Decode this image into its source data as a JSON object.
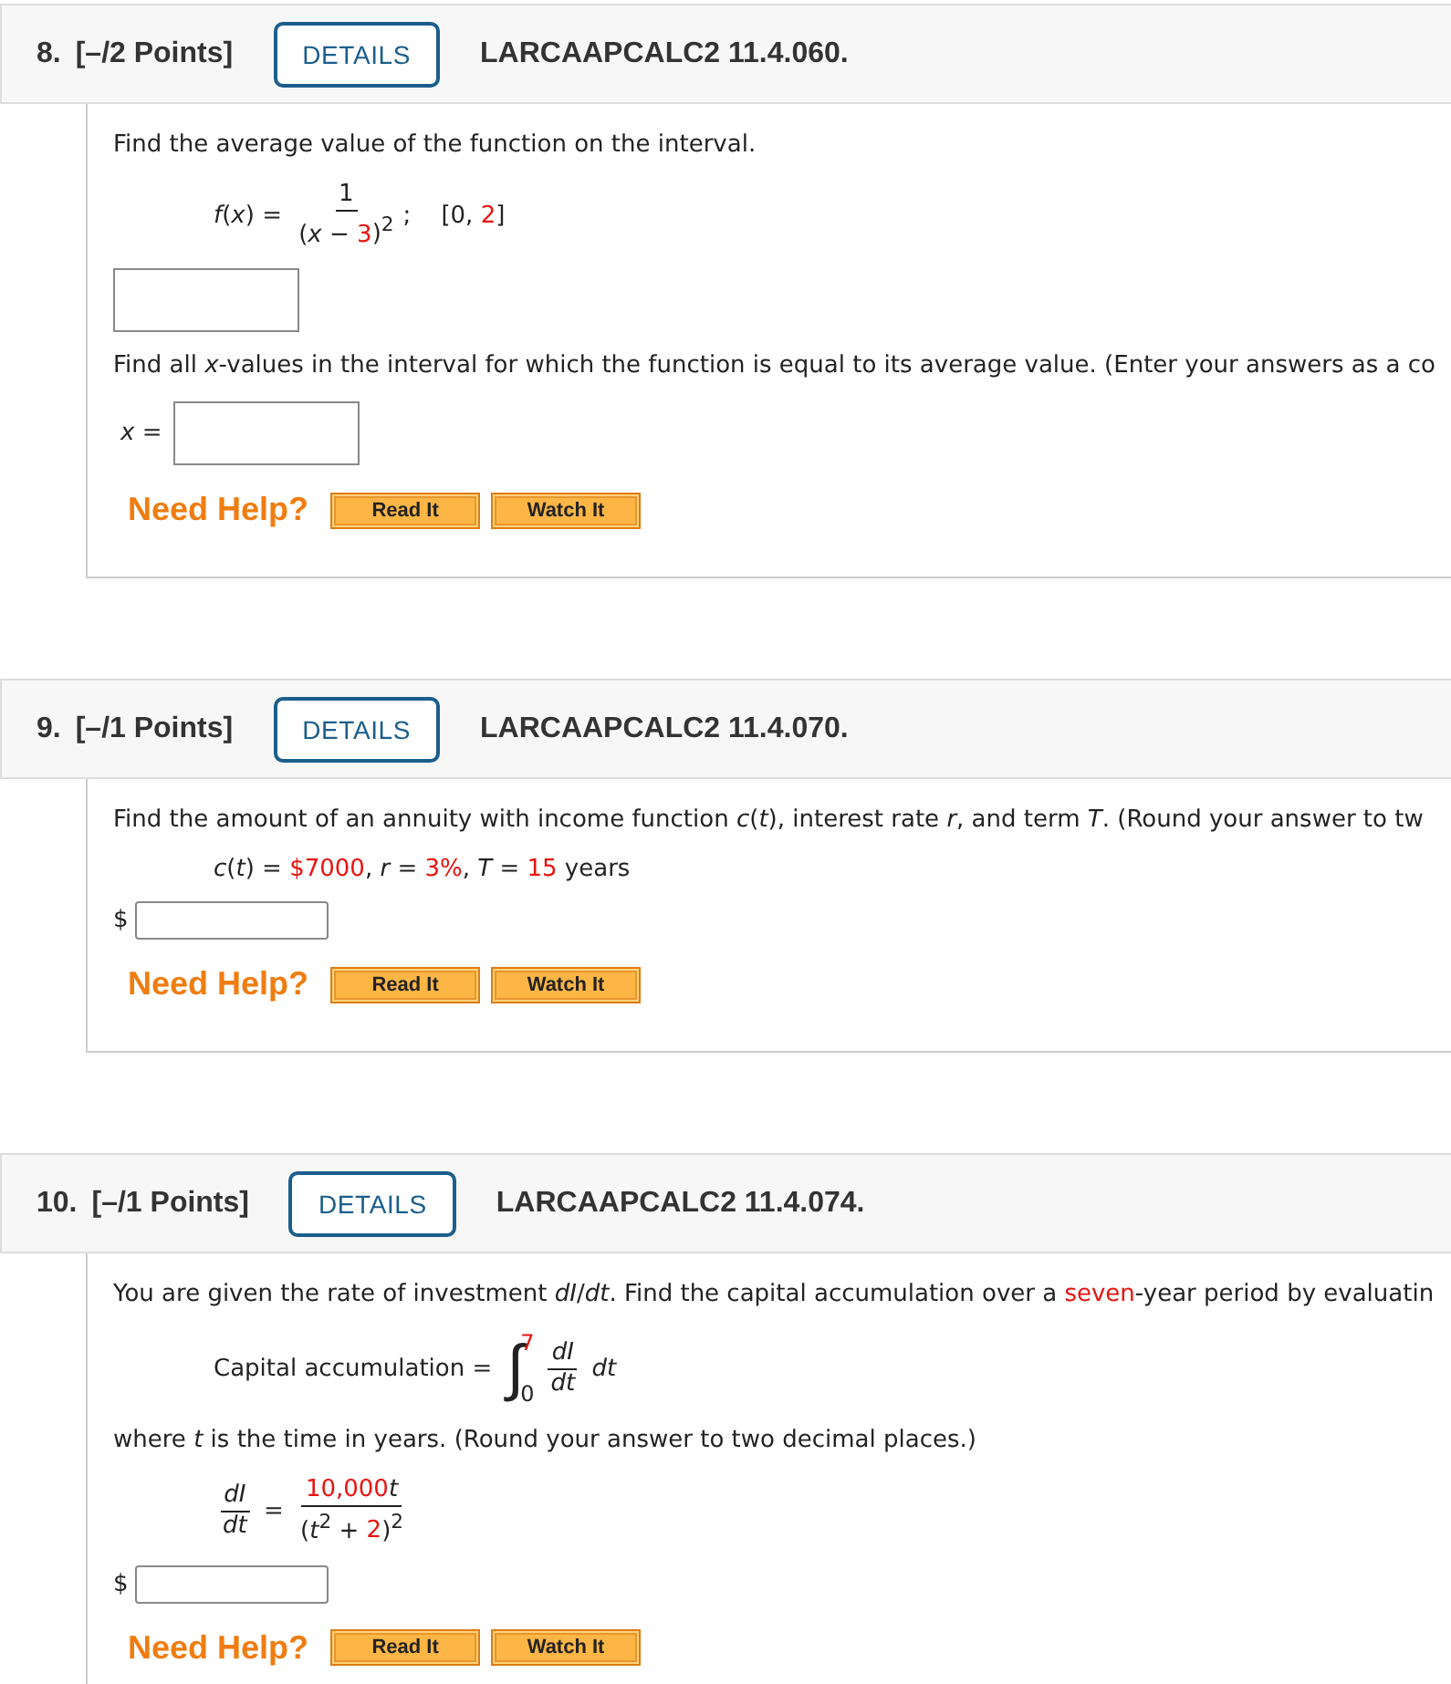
{
  "questions": [
    {
      "number": "8.",
      "points": "[–/2 Points]",
      "details_button": "DETAILS",
      "code": "LARCAAPCALC2 11.4.060.",
      "body": [
        {
          "kind": "text",
          "segments": [
            {
              "t": "Find the average value of the function on the interval.",
              "given": false
            }
          ]
        },
        {
          "kind": "formula",
          "parts": [
            {
              "kind": "seg",
              "segments": [
                {
                  "t": "*f*(*x*) = ",
                  "given": false
                }
              ]
            },
            {
              "kind": "frac",
              "num": [
                {
                  "t": "1",
                  "given": false
                }
              ],
              "den": [
                {
                  "t": "(*x* − ",
                  "given": false
                },
                {
                  "t": "3",
                  "given": true
                },
                {
                  "t": ")$^{2}$",
                  "given": false
                }
              ]
            },
            {
              "kind": "seg",
              "segments": [
                {
                  "t": ";    [0, ",
                  "given": false
                },
                {
                  "t": "2",
                  "given": true
                },
                {
                  "t": "]",
                  "given": false
                }
              ]
            }
          ]
        },
        {
          "kind": "box"
        },
        {
          "kind": "text",
          "segments": [
            {
              "t": "Find all *x*-values in the interval for which the function is equal to its average value. (Enter your answers as a co",
              "given": false
            }
          ]
        },
        {
          "kind": "labeled_box",
          "label": "*x* ="
        }
      ],
      "help": {
        "label": "Need Help?",
        "buttons": [
          "Read It",
          "Watch It"
        ]
      }
    },
    {
      "number": "9.",
      "points": "[–/1 Points]",
      "details_button": "DETAILS",
      "code": "LARCAAPCALC2 11.4.070.",
      "body": [
        {
          "kind": "text",
          "segments": [
            {
              "t": "Find the amount of an annuity with income function *c*(*t*), interest rate *r*, and term *T*. (Round your answer to tw",
              "given": false
            }
          ]
        },
        {
          "kind": "formula",
          "parts": [
            {
              "kind": "seg",
              "segments": [
                {
                  "t": "*c*(*t*) = ",
                  "given": false
                },
                {
                  "t": "$7000",
                  "given": true
                },
                {
                  "t": ", *r* = ",
                  "given": false
                },
                {
                  "t": "3%",
                  "given": true
                },
                {
                  "t": ", *T* = ",
                  "given": false
                },
                {
                  "t": "15",
                  "given": true
                },
                {
                  "t": " years",
                  "given": false
                }
              ]
            }
          ]
        },
        {
          "kind": "dollar",
          "label": "$"
        }
      ],
      "help": {
        "label": "Need Help?",
        "buttons": [
          "Read It",
          "Watch It"
        ]
      }
    },
    {
      "number": "10.",
      "points": "[–/1 Points]",
      "details_button": "DETAILS",
      "code": "LARCAAPCALC2 11.4.074.",
      "body": [
        {
          "kind": "text",
          "segments": [
            {
              "t": "You are given the rate of investment *dI*/*dt*. Find the capital accumulation over a ",
              "given": false
            },
            {
              "t": "seven",
              "given": true
            },
            {
              "t": "-year period by evaluatin",
              "given": false
            }
          ]
        },
        {
          "kind": "formula",
          "parts": [
            {
              "kind": "seg",
              "segments": [
                {
                  "t": "Capital accumulation = ",
                  "given": false
                }
              ]
            },
            {
              "kind": "integral",
              "sign": "∫",
              "upper": [
                {
                  "t": "7",
                  "given": true
                }
              ],
              "lower": [
                {
                  "t": "0",
                  "given": false
                }
              ]
            },
            {
              "kind": "frac",
              "num": [
                {
                  "t": "*dI*",
                  "given": false
                }
              ],
              "den": [
                {
                  "t": "*dt*",
                  "given": false
                }
              ]
            },
            {
              "kind": "seg",
              "segments": [
                {
                  "t": " *dt*",
                  "given": false
                }
              ]
            }
          ]
        },
        {
          "kind": "text",
          "segments": [
            {
              "t": "where *t* is the time in years. (Round your answer to two decimal places.)",
              "given": false
            }
          ]
        },
        {
          "kind": "formula",
          "parts": [
            {
              "kind": "frac",
              "num": [
                {
                  "t": "*dI*",
                  "given": false
                }
              ],
              "den": [
                {
                  "t": "*dt*",
                  "given": false
                }
              ]
            },
            {
              "kind": "seg",
              "segments": [
                {
                  "t": " = ",
                  "given": false
                }
              ]
            },
            {
              "kind": "frac",
              "num": [
                {
                  "t": "10,000",
                  "given": true
                },
                {
                  "t": "*t*",
                  "given": false
                }
              ],
              "den": [
                {
                  "t": "(*t*$^{2}$ + ",
                  "given": false
                },
                {
                  "t": "2",
                  "given": true
                },
                {
                  "t": ")$^{2}$",
                  "given": false
                }
              ]
            }
          ]
        },
        {
          "kind": "dollar",
          "label": "$"
        }
      ],
      "help": {
        "label": "Need Help?",
        "buttons": [
          "Read It",
          "Watch It"
        ]
      }
    }
  ]
}
